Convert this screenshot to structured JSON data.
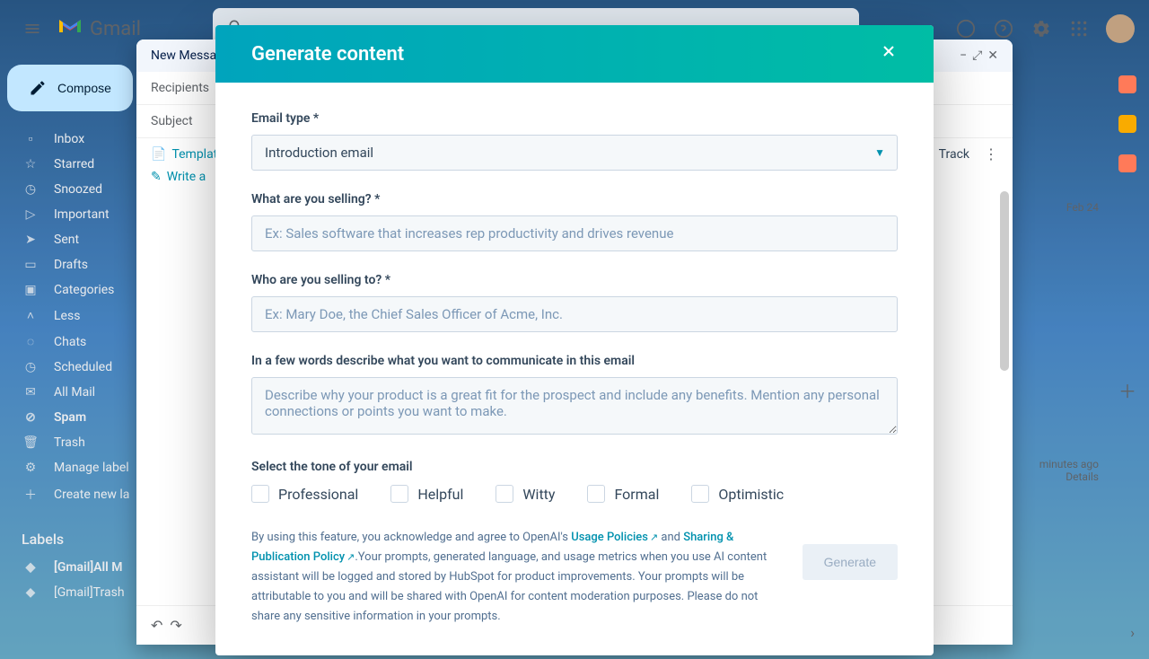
{
  "gmail": {
    "logo_text": "Gmail",
    "compose_label": "Compose",
    "sidebar_items": [
      {
        "icon": "inbox",
        "label": "Inbox"
      },
      {
        "icon": "star",
        "label": "Starred"
      },
      {
        "icon": "clock",
        "label": "Snoozed"
      },
      {
        "icon": "important",
        "label": "Important"
      },
      {
        "icon": "send",
        "label": "Sent"
      },
      {
        "icon": "draft",
        "label": "Drafts"
      },
      {
        "icon": "category",
        "label": "Categories"
      },
      {
        "icon": "less",
        "label": "Less"
      },
      {
        "icon": "chat",
        "label": "Chats"
      },
      {
        "icon": "schedule",
        "label": "Scheduled"
      },
      {
        "icon": "mail",
        "label": "All Mail"
      },
      {
        "icon": "spam",
        "label": "Spam",
        "bold": true
      },
      {
        "icon": "trash",
        "label": "Trash"
      },
      {
        "icon": "gear",
        "label": "Manage label"
      },
      {
        "icon": "plus",
        "label": "Create new la"
      }
    ],
    "labels_header": "Labels",
    "label_items": [
      {
        "label": "[Gmail]All M",
        "bold": true
      },
      {
        "label": "[Gmail]Trash"
      }
    ]
  },
  "compose": {
    "title": "New Message",
    "recipients_label": "Recipients",
    "subject_label": "Subject",
    "templates_label": "Template",
    "write_label": "Write a",
    "track_label": "Track"
  },
  "right_panel": {
    "time_label": "Feb 24",
    "activity_label": "minutes ago",
    "details_label": "Details"
  },
  "modal": {
    "title": "Generate content",
    "email_type_label": "Email type *",
    "email_type_value": "Introduction email",
    "selling_label": "What are you selling? *",
    "selling_placeholder": "Ex: Sales software that increases rep productivity and drives revenue",
    "audience_label": "Who are you selling to? *",
    "audience_placeholder": "Ex: Mary Doe, the Chief Sales Officer of Acme, Inc.",
    "describe_label": "In a few words describe what you want to communicate in this email",
    "describe_placeholder": "Describe why your product is a great fit for the prospect and include any benefits. Mention any personal connections or points you want to make.",
    "tone_label": "Select the tone of your email",
    "tones": [
      "Professional",
      "Helpful",
      "Witty",
      "Formal",
      "Optimistic"
    ],
    "disclaimer_prefix": "By using this feature, you acknowledge and agree to OpenAI's ",
    "usage_policies": "Usage Policies",
    "and_text": "  and  ",
    "sharing_policy": "Sharing & Publication Policy",
    "disclaimer_suffix": ".Your prompts, generated language, and usage metrics when you use AI content assistant will be logged and stored by HubSpot for product improvements. Your prompts will be attributable to you and will be shared with OpenAI for content moderation purposes. Please do not share any sensitive information in your prompts.",
    "generate_label": "Generate"
  }
}
